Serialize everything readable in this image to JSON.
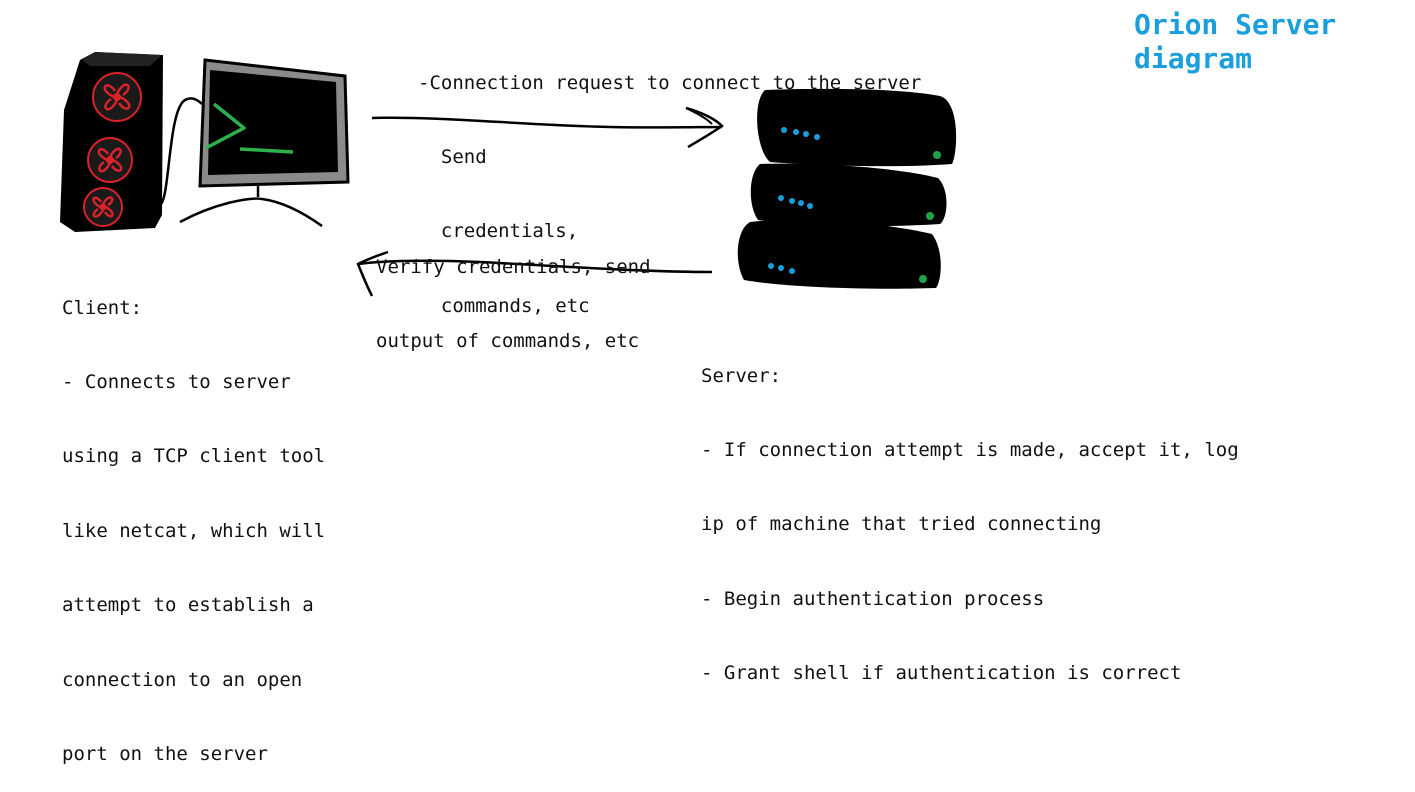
{
  "diagram": {
    "title": [
      "Orion Server",
      "diagram"
    ],
    "request_label": {
      "lines": [
        "-Connection request to connect to the server",
        "  Send",
        "  credentials,",
        "  commands, etc"
      ]
    },
    "response_label": {
      "lines": [
        "Verify credentials, send",
        "output of commands, etc"
      ]
    },
    "client": {
      "lines": [
        "Client:",
        "- Connects to server",
        "using a TCP client tool",
        "like netcat, which will",
        "attempt to establish a",
        "connection to an open",
        "port on the server"
      ]
    },
    "server": {
      "lines": [
        "Server:",
        "- If connection attempt is made, accept it, log",
        "ip of machine that tried connecting",
        "- Begin authentication process",
        "- Grant shell if authentication is correct"
      ]
    },
    "colors": {
      "title": "#1a9fdc",
      "server_leds": "#1a9fdc",
      "status_led": "#1fa34a",
      "fan": "#d9222a",
      "prompt": "#2bb24c",
      "monitor_frame": "#8a8a8a"
    },
    "icons": [
      "computer-tower-icon",
      "monitor-icon",
      "server-rack-icon",
      "arrow-right-icon",
      "arrow-left-icon"
    ]
  }
}
